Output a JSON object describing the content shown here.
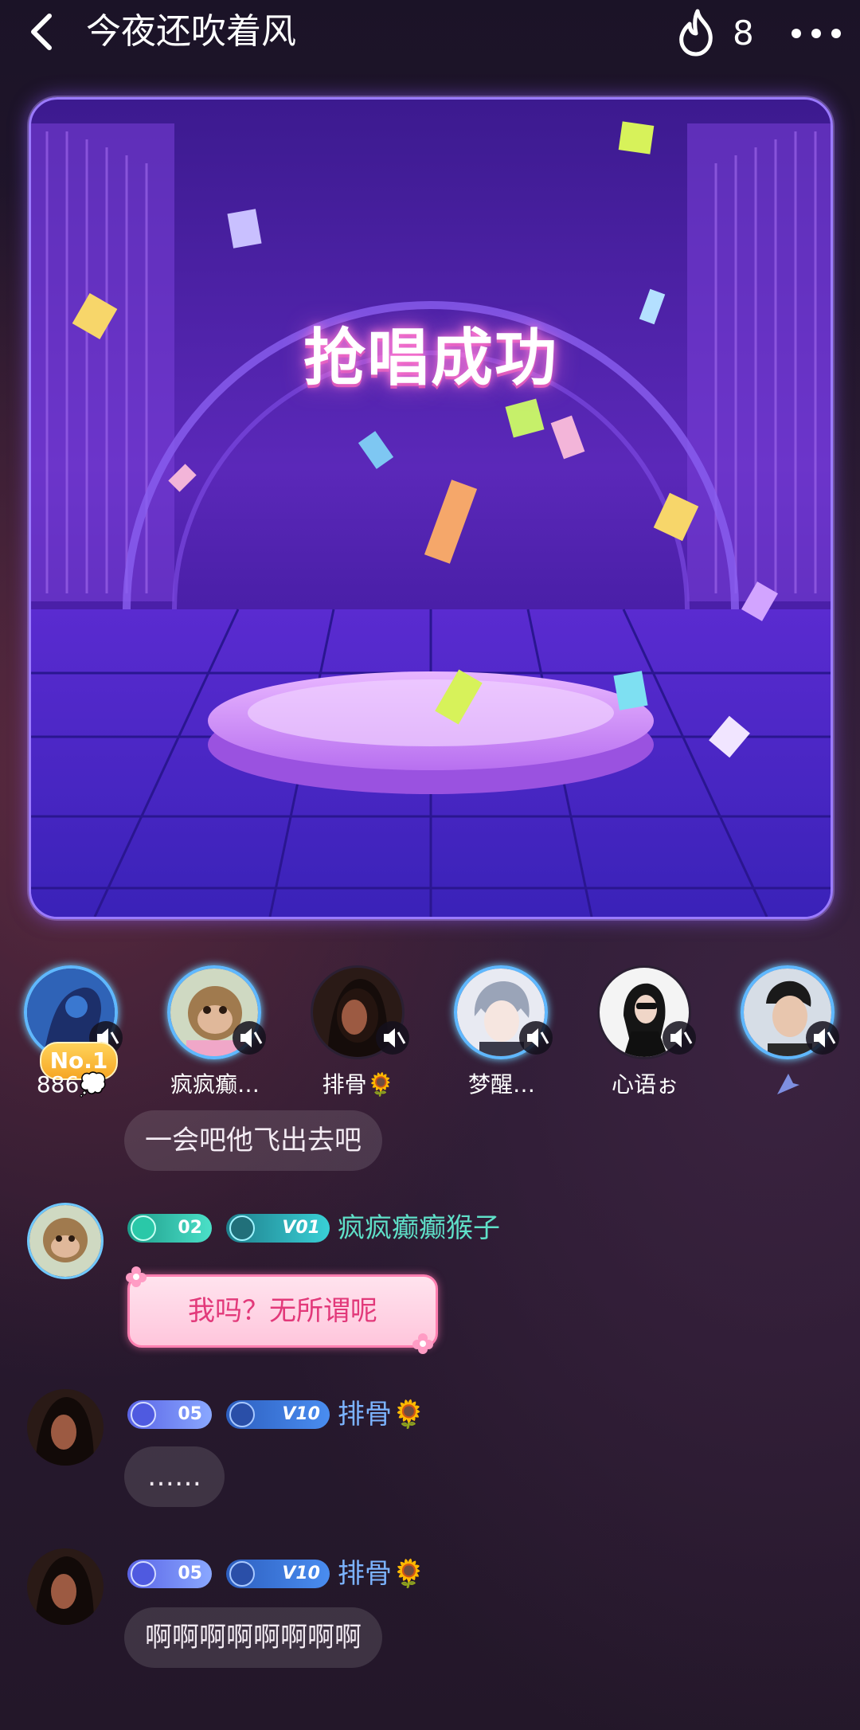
{
  "header": {
    "title": "今夜还吹着风",
    "heat_count": "8"
  },
  "stage": {
    "banner_text": "抢唱成功"
  },
  "seats": [
    {
      "name": "886💭",
      "badge": "No.1"
    },
    {
      "name": "疯疯癫…"
    },
    {
      "name": "排骨🌻"
    },
    {
      "name": "梦醒…"
    },
    {
      "name": "心语ぉ"
    },
    {
      "name": ""
    }
  ],
  "chat": {
    "partial_message": "一会吧他飞出去吧",
    "messages": [
      {
        "level": "02",
        "vip": "V01",
        "name": "疯疯癫癫猴子",
        "text": "我吗？无所谓呢",
        "name_color": "#5fe0c8"
      },
      {
        "level": "05",
        "vip": "V10",
        "name": "排骨🌻",
        "text": "……",
        "name_color": "#7cb4ff"
      },
      {
        "level": "05",
        "vip": "V10",
        "name": "排骨🌻",
        "text": "啊啊啊啊啊啊啊啊",
        "name_color": "#7cb4ff"
      }
    ]
  },
  "icons": {
    "back": "chevron-left-icon",
    "heat": "flame-icon",
    "more": "more-dots-icon",
    "mute": "mic-muted-icon"
  }
}
